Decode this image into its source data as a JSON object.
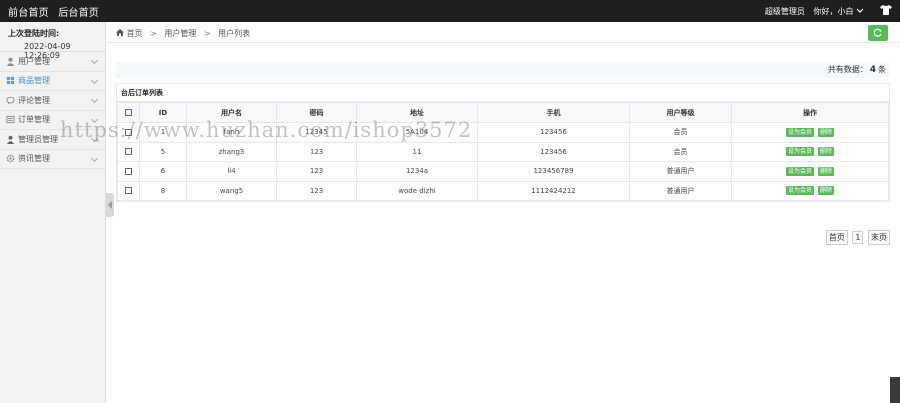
{
  "topbar": {
    "nav": [
      "前台首页",
      "后台首页"
    ],
    "role": "超级管理员",
    "greeting": "你好，小白"
  },
  "sidebar": {
    "last_login_label": "上次登陆时间:",
    "last_login_value": "2022-04-09 12:26:09",
    "items": [
      {
        "label": "用户管理",
        "icon": "user-icon"
      },
      {
        "label": "商品管理",
        "icon": "grid-icon"
      },
      {
        "label": "评论管理",
        "icon": "comment-icon"
      },
      {
        "label": "订单管理",
        "icon": "order-icon"
      },
      {
        "label": "管理员管理",
        "icon": "admin-icon"
      },
      {
        "label": "资讯管理",
        "icon": "gear-icon"
      }
    ]
  },
  "breadcrumb": {
    "items": [
      "首页",
      "用户管理",
      "用户列表"
    ],
    "sep": ">"
  },
  "summary": {
    "prefix": "共有数据：",
    "count": "4",
    "suffix": "条"
  },
  "table": {
    "title": "台后订单列表",
    "headers": [
      "",
      "ID",
      "用户名",
      "密码",
      "地址",
      "手机",
      "用户等级",
      "操作"
    ],
    "rows": [
      {
        "id": "1",
        "username": "fanh",
        "password": "12345",
        "address": "5A104",
        "phone": "123456",
        "level": "会员"
      },
      {
        "id": "5",
        "username": "zhang3",
        "password": "123",
        "address": "11",
        "phone": "123456",
        "level": "会员"
      },
      {
        "id": "6",
        "username": "li4",
        "password": "123",
        "address": "1234a",
        "phone": "123456789",
        "level": "普通用户"
      },
      {
        "id": "8",
        "username": "wang5",
        "password": "123",
        "address": "wode dizhi",
        "phone": "1112424212",
        "level": "普通用户"
      }
    ],
    "btn_member": "设为会员",
    "btn_delete": "删除"
  },
  "pager": {
    "first": "首页",
    "page": "1",
    "last": "末页"
  },
  "watermark": "https://www.huzhan.com/ishop3572",
  "colors": {
    "topbar": "#1f1f1f",
    "accent_green": "#5cb85c",
    "active_menu": "#4a90c8"
  }
}
